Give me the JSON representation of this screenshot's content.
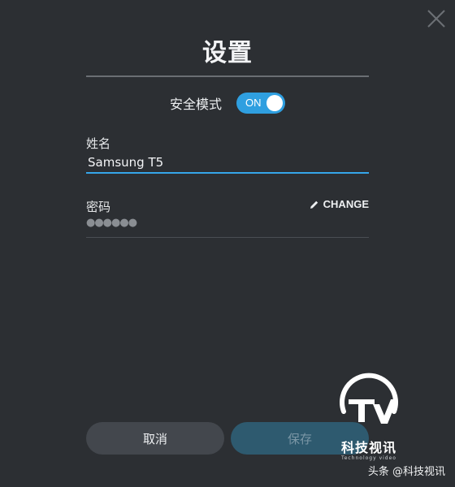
{
  "dialog": {
    "title": "设置",
    "close_icon": "close-icon"
  },
  "safe_mode": {
    "label": "安全模式",
    "toggle_text": "ON",
    "enabled": true,
    "accent_color": "#2f9fe0"
  },
  "name_field": {
    "label": "姓名",
    "value": "Samsung T5"
  },
  "password_field": {
    "label": "密码",
    "masked_value": "●●●●●●",
    "change_label": "CHANGE",
    "change_icon": "pencil-icon"
  },
  "buttons": {
    "cancel_label": "取消",
    "save_label": "保存"
  },
  "watermark": {
    "name": "科技视讯",
    "subtitle": "Technology video"
  },
  "credit": {
    "text": "头条 @科技视讯"
  }
}
